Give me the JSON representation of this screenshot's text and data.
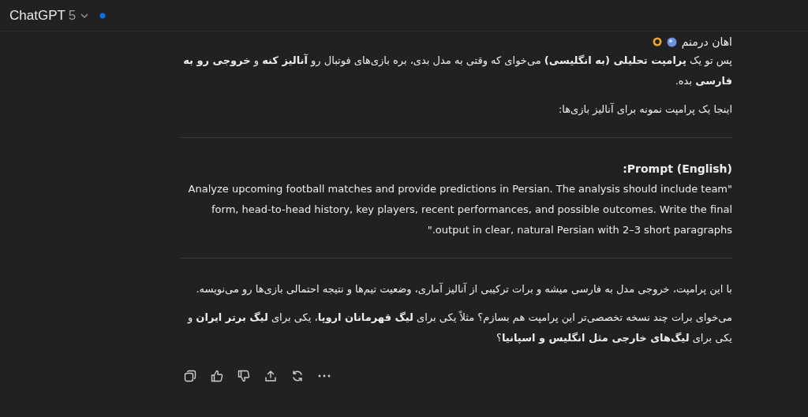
{
  "header": {
    "title": "ChatGPT",
    "version": "5"
  },
  "message": [
    {
      "kind": "partial",
      "text": "اهان درمنم"
    },
    {
      "kind": "paragraph",
      "text": "پس تو یک **پرامپت تحلیلی (به انگلیسی)** می‌خوای که وقتی به مدل بدی، بره بازی‌های فوتبال رو **آنالیز کنه** و **خروجی رو به فارسی** بده."
    },
    {
      "kind": "paragraph",
      "text": "اینجا یک پرامپت نمونه برای آنالیز بازی‌ها:"
    },
    {
      "kind": "divider"
    },
    {
      "kind": "label",
      "text": "Prompt (English):"
    },
    {
      "kind": "paragraph",
      "text": "\"Analyze upcoming football matches and provide predictions in Persian. The analysis should include team form, head-to-head history, key players, recent performances, and possible outcomes. Write the final output in clear, natural Persian with 2–3 short paragraphs.\""
    },
    {
      "kind": "divider"
    },
    {
      "kind": "paragraph",
      "text": "با این پرامپت، خروجی مدل به فارسی میشه و برات ترکیبی از آنالیز آماری، وضعیت تیم‌ها و نتیجه احتمالی بازی‌ها رو می‌نویسه."
    },
    {
      "kind": "paragraph",
      "text": "می‌خوای برات چند نسخه تخصصی‌تر این پرامپت هم بسازم؟ مثلاً یکی برای **لیگ قهرمانان اروپا**، یکی برای **لیگ برتر ایران** و یکی برای **لیگ‌های خارجی مثل انگلیس و اسپانیا**؟"
    }
  ]
}
